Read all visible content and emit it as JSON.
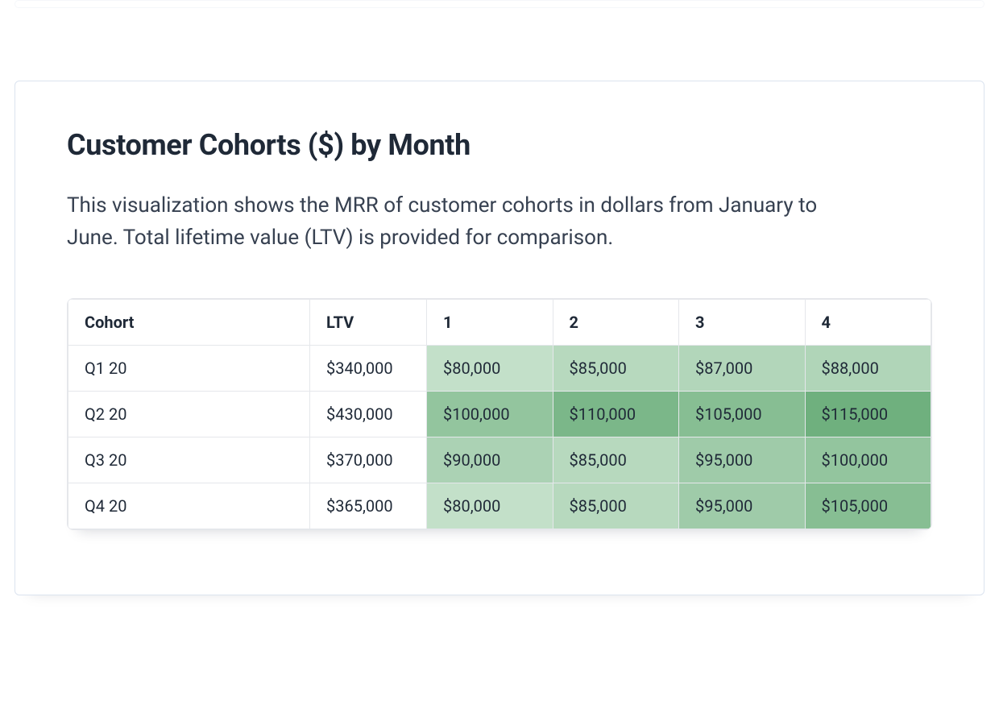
{
  "page": {
    "title": "Customer Cohorts ($) by Month",
    "description": "This visualization shows the MRR of customer cohorts in dollars from January to June. Total lifetime value (LTV) is provided for comparison."
  },
  "table": {
    "headers": {
      "cohort": "Cohort",
      "ltv": "LTV",
      "months": [
        "1",
        "2",
        "3",
        "4"
      ]
    },
    "rows": [
      {
        "cohort": "Q1 20",
        "ltv": "$340,000",
        "months": [
          "$80,000",
          "$85,000",
          "$87,000",
          "$88,000"
        ]
      },
      {
        "cohort": "Q2 20",
        "ltv": "$430,000",
        "months": [
          "$100,000",
          "$110,000",
          "$105,000",
          "$115,000"
        ]
      },
      {
        "cohort": "Q3 20",
        "ltv": "$370,000",
        "months": [
          "$90,000",
          "$85,000",
          "$95,000",
          "$100,000"
        ]
      },
      {
        "cohort": "Q4 20",
        "ltv": "$365,000",
        "months": [
          "$80,000",
          "$85,000",
          "$95,000",
          "$105,000"
        ]
      }
    ]
  },
  "chart_data": {
    "type": "heatmap",
    "title": "Customer Cohorts ($) by Month",
    "xlabel": "Month",
    "ylabel": "Cohort",
    "x": [
      "1",
      "2",
      "3",
      "4"
    ],
    "y": [
      "Q1 20",
      "Q2 20",
      "Q3 20",
      "Q4 20"
    ],
    "ltv": [
      340000,
      430000,
      370000,
      365000
    ],
    "values": [
      [
        80000,
        85000,
        87000,
        88000
      ],
      [
        100000,
        110000,
        105000,
        115000
      ],
      [
        90000,
        85000,
        95000,
        100000
      ],
      [
        80000,
        85000,
        95000,
        105000
      ]
    ],
    "color_scale": {
      "low": "#c3e0c9",
      "high": "#6fb07e"
    }
  }
}
